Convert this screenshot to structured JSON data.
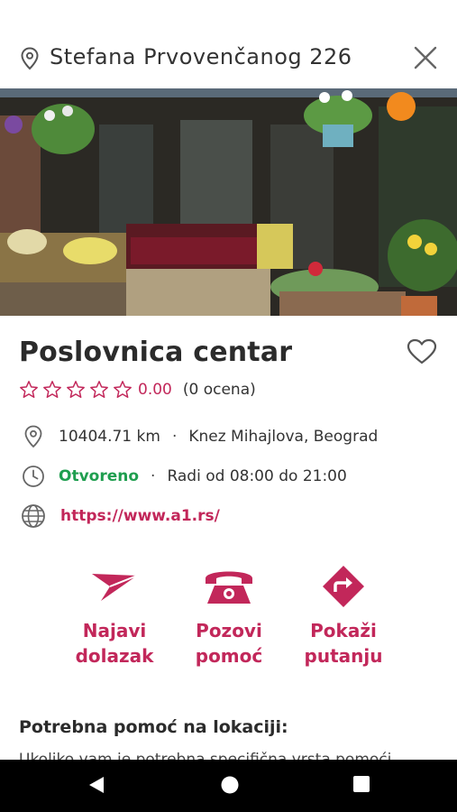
{
  "header": {
    "address": "Stefana Prvovenčanog 226",
    "location_icon": "map-pin-icon",
    "close_icon": "close-icon"
  },
  "hero": {
    "image": "store-front-with-fruit-and-flowers-photo"
  },
  "place": {
    "name": "Poslovnica centar",
    "rating_value": "0.00",
    "rating_count": "(0 ocena)",
    "max_stars": 5,
    "distance": "10404.71 km",
    "separator": "·",
    "street": "Knez Mihajlova, Beograd",
    "status": "Otvoreno",
    "hours": "Radi od 08:00 do 21:00",
    "website": "https://www.a1.rs/"
  },
  "actions": {
    "announce": "Najavi\ndolazak",
    "call": "Pozovi\npomoć",
    "directions": "Pokaži\nputanju"
  },
  "section": {
    "title": "Potrebna pomoć na lokaciji:",
    "text": "Ukoliko vam je potrebna specifična vrsta pomoći"
  },
  "colors": {
    "accent": "#c2275a",
    "open": "#1f9e4f",
    "navbar": "#000000"
  }
}
